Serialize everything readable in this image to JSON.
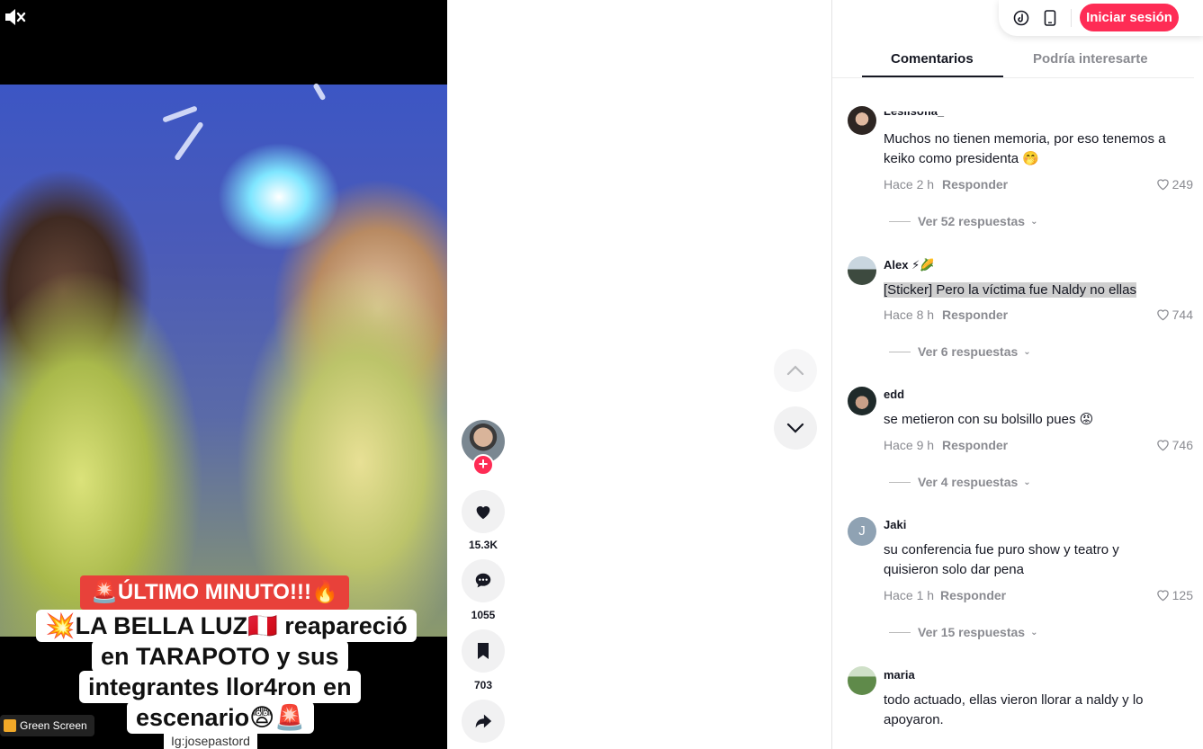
{
  "video": {
    "banner_top": "🚨ÚLTIMO MINUTO!!!🔥",
    "caption_lines": [
      "💥LA BELLA LUZ🇵🇪 reapareció",
      "en TARAPOTO y sus",
      "integrantes llor4ron en",
      "escenario😨🚨"
    ],
    "effect_label": "Green Screen",
    "watermark": "Ig:josepastord"
  },
  "actions": {
    "likes": "15.3K",
    "comments": "1055",
    "saves": "703"
  },
  "header": {
    "login_label": "Iniciar sesión"
  },
  "tabs": [
    {
      "label": "Comentarios"
    },
    {
      "label": "Podría interesarte"
    }
  ],
  "comments": [
    {
      "user": "Lesiisofia_",
      "text": "Muchos no tienen memoria, por eso tenemos a keiko como presidenta 🤭",
      "time": "Hace 2 h",
      "reply": "Responder",
      "likes": "249",
      "replies": "Ver 52 respuestas"
    },
    {
      "user": "Alex ⚡🌽",
      "text": "[Sticker] Pero la víctima fue Naldy no ellas",
      "time": "Hace 8 h",
      "reply": "Responder",
      "likes": "744",
      "replies": "Ver 6 respuestas"
    },
    {
      "user": "edd",
      "text": "se metieron con su bolsillo pues 😡",
      "time": "Hace 9 h",
      "reply": "Responder",
      "likes": "746",
      "replies": "Ver 4 respuestas"
    },
    {
      "user": "Jaki",
      "avatar_letter": "J",
      "text": "su conferencia fue puro show y teatro y quisieron solo dar pena",
      "time": "Hace 1 h",
      "reply": "Responder",
      "likes": "125",
      "replies": "Ver 15 respuestas"
    },
    {
      "user": "maria",
      "text": "todo actuado, ellas vieron llorar a naldy y lo apoyaron."
    }
  ],
  "colors": {
    "accent": "#fe2c55",
    "muted": "#8a8b91",
    "banner_red": "#e8413a"
  }
}
